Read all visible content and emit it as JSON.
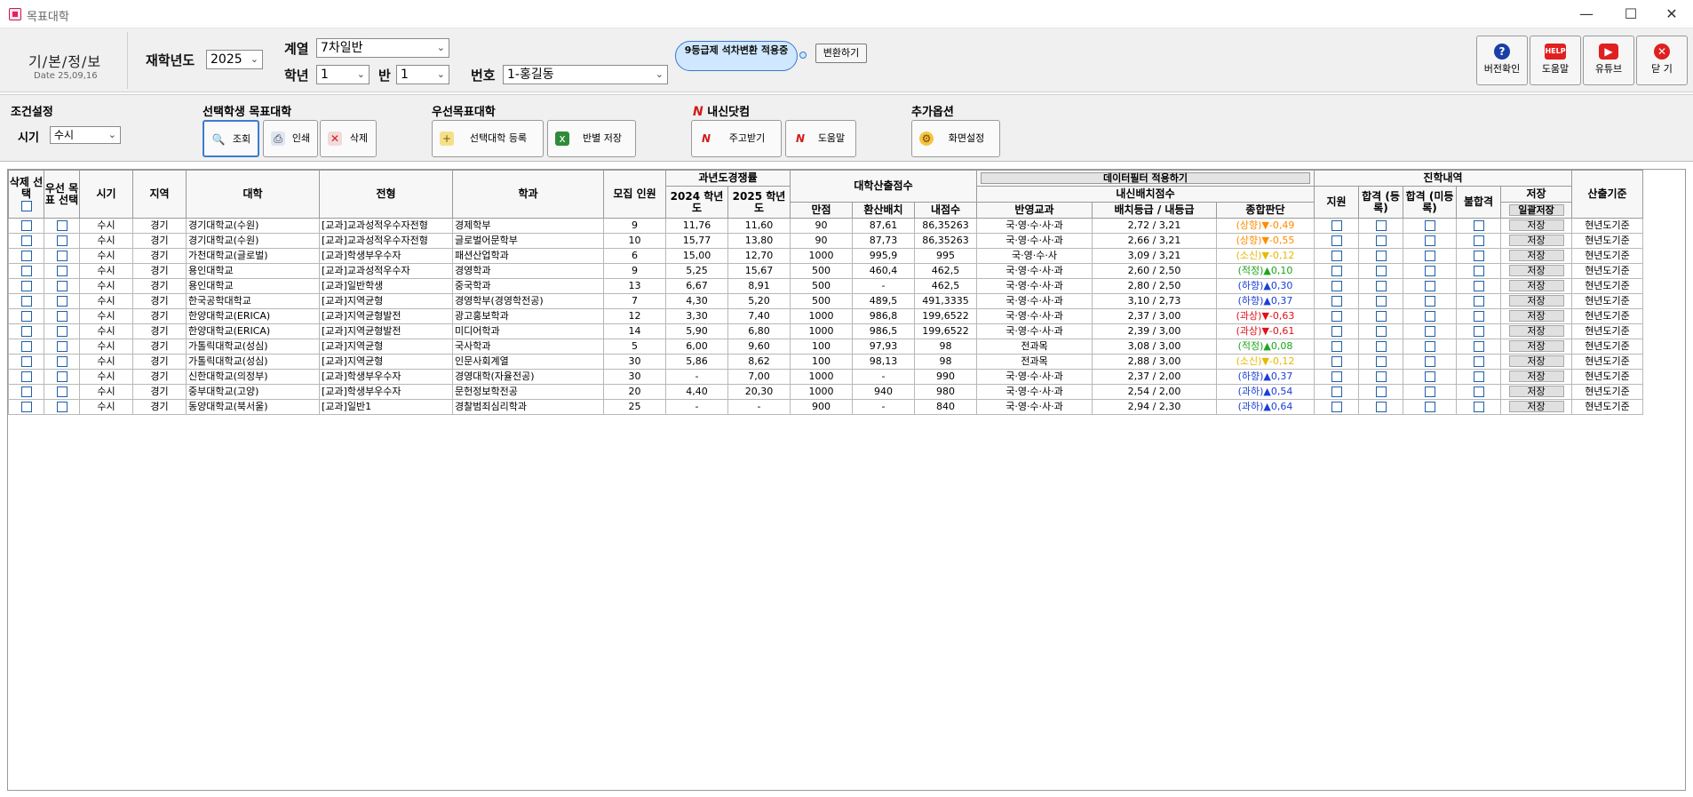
{
  "window": {
    "title": "목표대학",
    "controls": [
      "—",
      "☐",
      "✕"
    ]
  },
  "header": {
    "logo": "기/본/정/보",
    "date": "Date 25,09,16",
    "year_label": "재학년도",
    "year_value": "2025",
    "track_label": "계열",
    "track_value": "7차일반",
    "grade_label": "학년",
    "grade_value": "1",
    "class_label": "반",
    "class_value": "1",
    "number_label": "번호",
    "number_value": "1-홍길동",
    "bubble_text": "9등급제 석차변환 적용중",
    "convert_button": "변환하기",
    "side_buttons": {
      "version": "버전확인",
      "help": "도움말",
      "youtube": "유튜브",
      "close": "닫 기"
    }
  },
  "options": {
    "condition_title": "조건설정",
    "period_label": "시기",
    "period_value": "수시",
    "selected_title": "선택학생 목표대학",
    "btn_search": "조회",
    "btn_print": "인쇄",
    "btn_delete": "삭제",
    "priority_title": "우선목표대학",
    "btn_register": "선택대학 등록",
    "btn_class_save": "반별 저장",
    "naesin_title": "내신닷컴",
    "btn_receive": "주고받기",
    "btn_naesin_help": "도움말",
    "extra_title": "추가옵션",
    "btn_screen": "화면설정"
  },
  "table": {
    "headers": {
      "delete_select": "삭제 선택",
      "priority_select": "우선 목표 선택",
      "period": "시기",
      "region": "지역",
      "university": "대학",
      "admission_type": "전형",
      "department": "학과",
      "recruit": "모집 인원",
      "prev_competition": "과년도경쟁률",
      "year2024": "2024 학년도",
      "year2025": "2025 학년도",
      "univ_score": "대학산출점수",
      "full_score": "만점",
      "converted": "환산배치",
      "my_score": "내점수",
      "data_filter": "데이터필터 적용하기",
      "naesin_score": "내신배치점수",
      "subjects": "반영교과",
      "grade_compare": "배치등급 / 내등급",
      "overall": "종합판단",
      "career_history": "진학내역",
      "applied": "지원",
      "pass_registered": "합격 (등록)",
      "pass_unregistered": "합격 (미등록)",
      "fail": "불합격",
      "save": "저장",
      "bulk_save": "일괄저장",
      "calc_basis": "산출기준"
    },
    "save_label": "저장",
    "rows": [
      {
        "period": "수시",
        "region": "경기",
        "univ": "경기대학교(수원)",
        "type": "[교과]교과성적우수자전형",
        "dept": "경제학부",
        "recruit": "9",
        "y2024": "11,76",
        "y2025": "11,60",
        "full": "90",
        "conv": "87,61",
        "mine": "86,35263",
        "subj": "국·영·수·사·과",
        "grade": "2,72 / 3,21",
        "judge": "(상향)▼-0,49",
        "judge_color": "#ff8c00",
        "basis": "현년도기준"
      },
      {
        "period": "수시",
        "region": "경기",
        "univ": "경기대학교(수원)",
        "type": "[교과]교과성적우수자전형",
        "dept": "글로벌어문학부",
        "recruit": "10",
        "y2024": "15,77",
        "y2025": "13,80",
        "full": "90",
        "conv": "87,73",
        "mine": "86,35263",
        "subj": "국·영·수·사·과",
        "grade": "2,66 / 3,21",
        "judge": "(상향)▼-0,55",
        "judge_color": "#ff8c00",
        "basis": "현년도기준"
      },
      {
        "period": "수시",
        "region": "경기",
        "univ": "가천대학교(글로벌)",
        "type": "[교과]학생부우수자",
        "dept": "패션산업학과",
        "recruit": "6",
        "y2024": "15,00",
        "y2025": "12,70",
        "full": "1000",
        "conv": "995,9",
        "mine": "995",
        "subj": "국·영·수·사",
        "grade": "3,09 / 3,21",
        "judge": "(소신)▼-0,12",
        "judge_color": "#e6b800",
        "basis": "현년도기준"
      },
      {
        "period": "수시",
        "region": "경기",
        "univ": "용인대학교",
        "type": "[교과]교과성적우수자",
        "dept": "경영학과",
        "recruit": "9",
        "y2024": "5,25",
        "y2025": "15,67",
        "full": "500",
        "conv": "460,4",
        "mine": "462,5",
        "subj": "국·영·수·사·과",
        "grade": "2,60 / 2,50",
        "judge": "(적정)▲0,10",
        "judge_color": "#1aa51a",
        "basis": "현년도기준"
      },
      {
        "period": "수시",
        "region": "경기",
        "univ": "용인대학교",
        "type": "[교과]일반학생",
        "dept": "중국학과",
        "recruit": "13",
        "y2024": "6,67",
        "y2025": "8,91",
        "full": "500",
        "conv": "-",
        "mine": "462,5",
        "subj": "국·영·수·사·과",
        "grade": "2,80 / 2,50",
        "judge": "(하향)▲0,30",
        "judge_color": "#1a3fd6",
        "basis": "현년도기준"
      },
      {
        "period": "수시",
        "region": "경기",
        "univ": "한국공학대학교",
        "type": "[교과]지역균형",
        "dept": "경영학부(경영학전공)",
        "recruit": "7",
        "y2024": "4,30",
        "y2025": "5,20",
        "full": "500",
        "conv": "489,5",
        "mine": "491,3335",
        "subj": "국·영·수·사·과",
        "grade": "3,10 / 2,73",
        "judge": "(하향)▲0,37",
        "judge_color": "#1a3fd6",
        "basis": "현년도기준"
      },
      {
        "period": "수시",
        "region": "경기",
        "univ": "한양대학교(ERICA)",
        "type": "[교과]지역균형발전",
        "dept": "광고홍보학과",
        "recruit": "12",
        "y2024": "3,30",
        "y2025": "7,40",
        "full": "1000",
        "conv": "986,8",
        "mine": "199,6522",
        "subj": "국·영·수·사·과",
        "grade": "2,37 / 3,00",
        "judge": "(과상)▼-0,63",
        "judge_color": "#e0101a",
        "basis": "현년도기준"
      },
      {
        "period": "수시",
        "region": "경기",
        "univ": "한양대학교(ERICA)",
        "type": "[교과]지역균형발전",
        "dept": "미디어학과",
        "recruit": "14",
        "y2024": "5,90",
        "y2025": "6,80",
        "full": "1000",
        "conv": "986,5",
        "mine": "199,6522",
        "subj": "국·영·수·사·과",
        "grade": "2,39 / 3,00",
        "judge": "(과상)▼-0,61",
        "judge_color": "#e0101a",
        "basis": "현년도기준"
      },
      {
        "period": "수시",
        "region": "경기",
        "univ": "가톨릭대학교(성심)",
        "type": "[교과]지역균형",
        "dept": "국사학과",
        "recruit": "5",
        "y2024": "6,00",
        "y2025": "9,60",
        "full": "100",
        "conv": "97,93",
        "mine": "98",
        "subj": "전과목",
        "grade": "3,08 / 3,00",
        "judge": "(적정)▲0,08",
        "judge_color": "#1aa51a",
        "basis": "현년도기준"
      },
      {
        "period": "수시",
        "region": "경기",
        "univ": "가톨릭대학교(성심)",
        "type": "[교과]지역균형",
        "dept": "인문사회계열",
        "recruit": "30",
        "y2024": "5,86",
        "y2025": "8,62",
        "full": "100",
        "conv": "98,13",
        "mine": "98",
        "subj": "전과목",
        "grade": "2,88 / 3,00",
        "judge": "(소신)▼-0,12",
        "judge_color": "#e6b800",
        "basis": "현년도기준"
      },
      {
        "period": "수시",
        "region": "경기",
        "univ": "신한대학교(의정부)",
        "type": "[교과]학생부우수자",
        "dept": "경영대학(자율전공)",
        "recruit": "30",
        "y2024": "-",
        "y2025": "7,00",
        "full": "1000",
        "conv": "-",
        "mine": "990",
        "subj": "국·영·수·사·과",
        "grade": "2,37 / 2,00",
        "judge": "(하향)▲0,37",
        "judge_color": "#1a3fd6",
        "basis": "현년도기준"
      },
      {
        "period": "수시",
        "region": "경기",
        "univ": "중부대학교(고양)",
        "type": "[교과]학생부우수자",
        "dept": "문헌정보학전공",
        "recruit": "20",
        "y2024": "4,40",
        "y2025": "20,30",
        "full": "1000",
        "conv": "940",
        "mine": "980",
        "subj": "국·영·수·사·과",
        "grade": "2,54 / 2,00",
        "judge": "(과하)▲0,54",
        "judge_color": "#1a3fd6",
        "basis": "현년도기준"
      },
      {
        "period": "수시",
        "region": "경기",
        "univ": "동양대학교(북서울)",
        "type": "[교과]일반1",
        "dept": "경찰범죄심리학과",
        "recruit": "25",
        "y2024": "-",
        "y2025": "-",
        "full": "900",
        "conv": "-",
        "mine": "840",
        "subj": "국·영·수·사·과",
        "grade": "2,94 / 2,30",
        "judge": "(과하)▲0,64",
        "judge_color": "#1a3fd6",
        "basis": "현년도기준"
      }
    ]
  }
}
